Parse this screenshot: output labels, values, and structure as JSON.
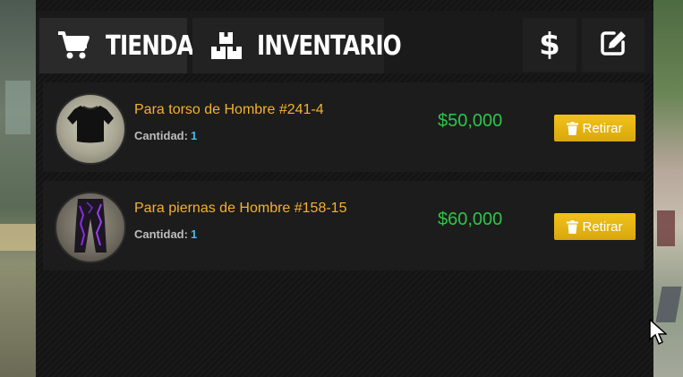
{
  "tabs": {
    "shop_label": "TIENDA",
    "inventory_label": "INVENTARIO"
  },
  "toolbar": {
    "money_glyph": "$"
  },
  "items": [
    {
      "name": "Para torso de Hombre #241-4",
      "quantity_label": "Cantidad:",
      "quantity": "1",
      "price": "$50,000",
      "action_label": "Retirar",
      "image_icon": "tshirt-icon"
    },
    {
      "name": "Para piernas de Hombre #158-15",
      "quantity_label": "Cantidad:",
      "quantity": "1",
      "price": "$60,000",
      "action_label": "Retirar",
      "image_icon": "pants-icon"
    }
  ],
  "colors": {
    "item_name": "#f2b230",
    "price": "#2fc54a",
    "quantity_value": "#4fb6e8",
    "button": "#e0b010",
    "panel": "#141414"
  }
}
